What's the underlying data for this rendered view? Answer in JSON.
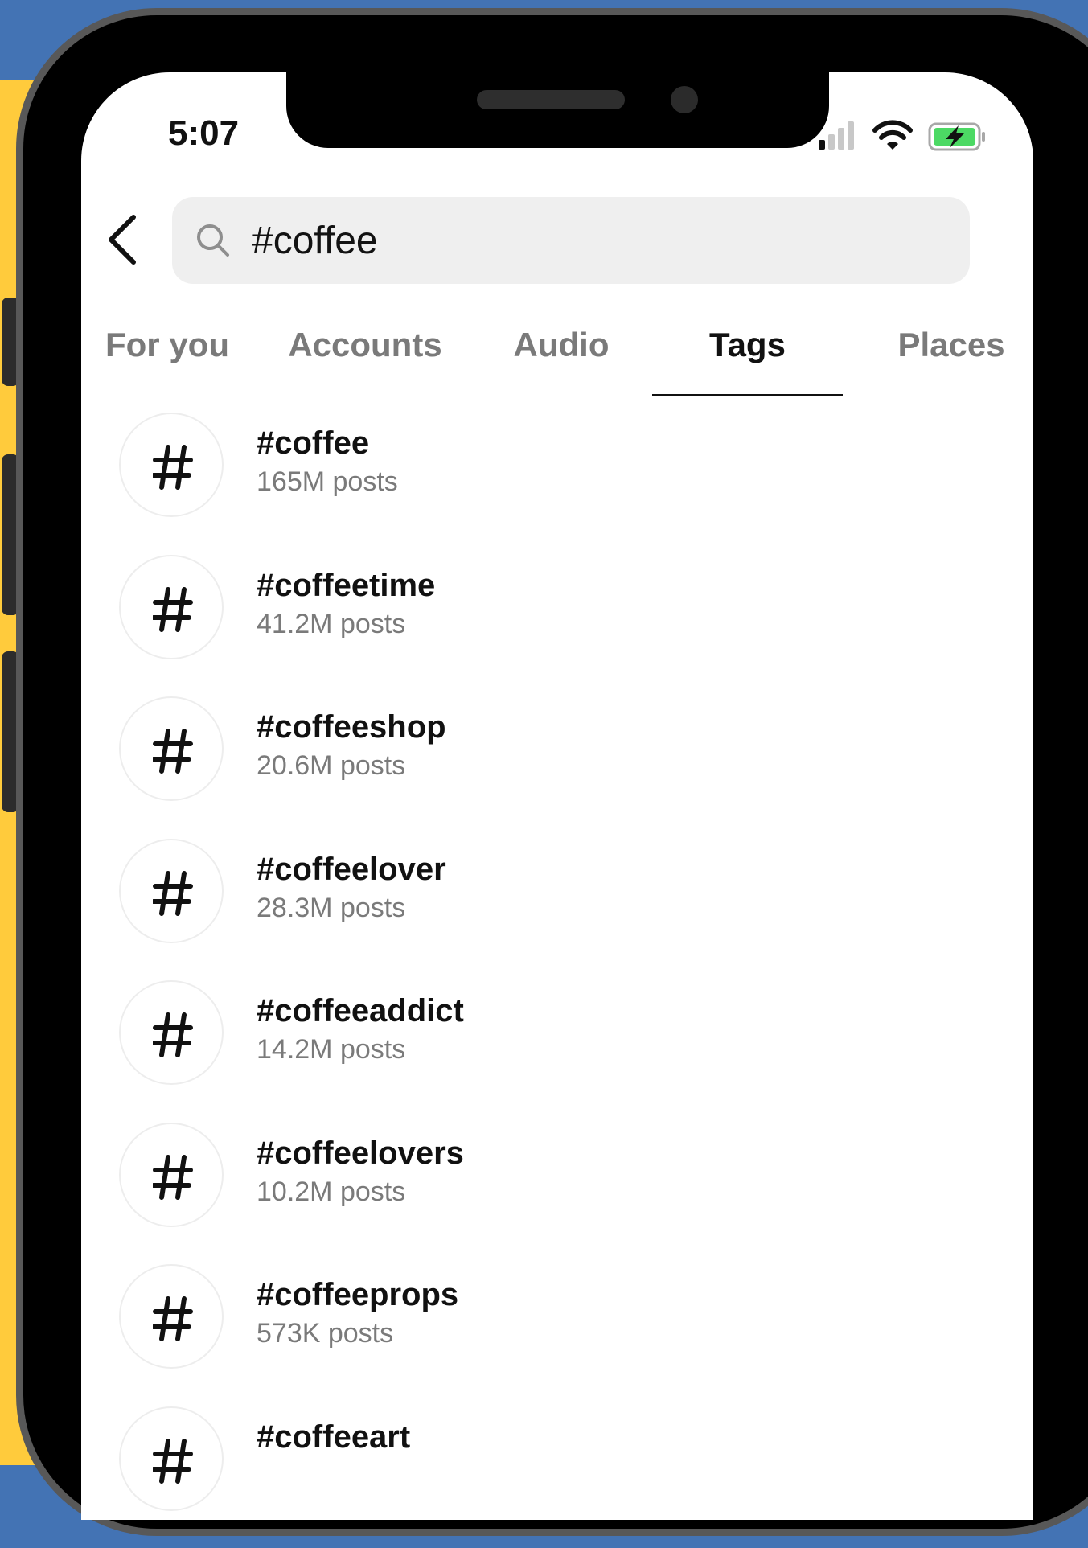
{
  "status_bar": {
    "time": "5:07"
  },
  "search": {
    "query": "#coffee"
  },
  "tabs": [
    {
      "label": "For you",
      "active": false
    },
    {
      "label": "Accounts",
      "active": false
    },
    {
      "label": "Audio",
      "active": false
    },
    {
      "label": "Tags",
      "active": true
    },
    {
      "label": "Places",
      "active": false
    }
  ],
  "results": [
    {
      "tag": "#coffee",
      "count": "165M posts"
    },
    {
      "tag": "#coffeetime",
      "count": "41.2M posts"
    },
    {
      "tag": "#coffeeshop",
      "count": "20.6M posts"
    },
    {
      "tag": "#coffeelover",
      "count": "28.3M posts"
    },
    {
      "tag": "#coffeeaddict",
      "count": "14.2M posts"
    },
    {
      "tag": "#coffeelovers",
      "count": "10.2M posts"
    },
    {
      "tag": "#coffeeprops",
      "count": "573K posts"
    },
    {
      "tag": "#coffeeart",
      "count": ""
    }
  ],
  "icons": {
    "back": "chevron-left-icon",
    "search": "search-icon",
    "hashtag": "hashtag-icon",
    "signal": "signal-icon",
    "wifi": "wifi-icon",
    "battery": "battery-charging-icon"
  },
  "colors": {
    "background_top": "#4373b4",
    "background_bottom": "#ffcb3c",
    "battery_fill": "#4cd964"
  }
}
